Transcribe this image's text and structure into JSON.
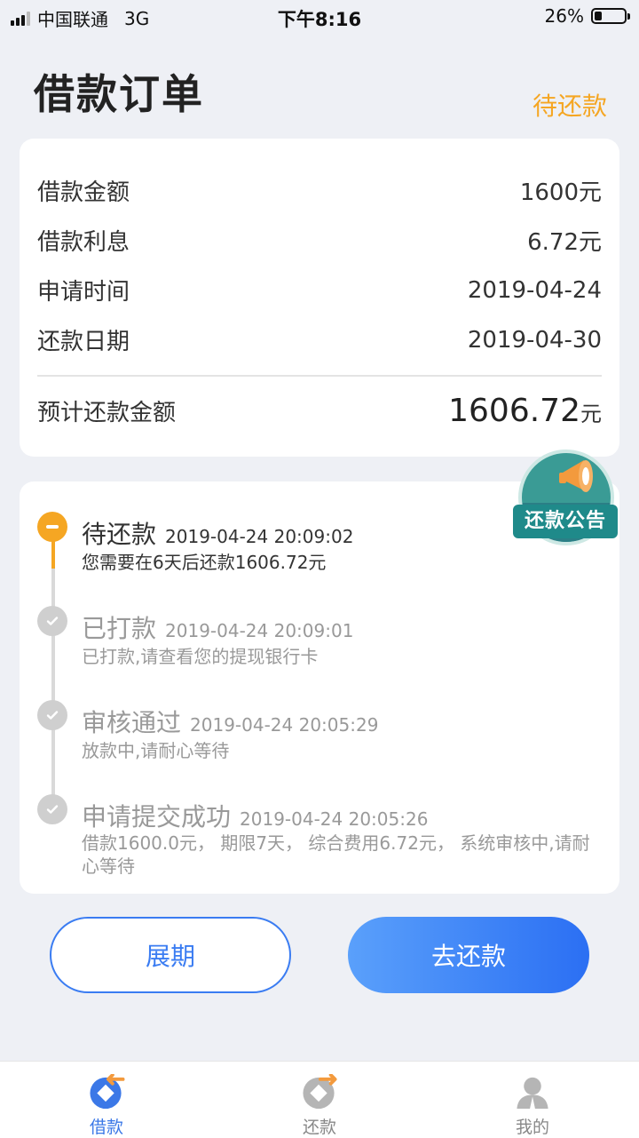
{
  "status_bar": {
    "carrier": "中国联通",
    "network": "3G",
    "time": "下午8:16",
    "battery": "26%",
    "battery_level": 0.26
  },
  "header": {
    "title": "借款订单",
    "status": "待还款"
  },
  "summary": {
    "rows": [
      {
        "label": "借款金额",
        "value": "1600元"
      },
      {
        "label": "借款利息",
        "value": "6.72元"
      },
      {
        "label": "申请时间",
        "value": "2019-04-24"
      },
      {
        "label": "还款日期",
        "value": "2019-04-30"
      }
    ],
    "total": {
      "label": "预计还款金额",
      "value": "1606.72",
      "unit": "元"
    }
  },
  "timeline": [
    {
      "title": "待还款",
      "time": "2019-04-24 20:09:02",
      "desc": "您需要在6天后还款1606.72元",
      "state": "active"
    },
    {
      "title": "已打款",
      "time": "2019-04-24 20:09:01",
      "desc": "已打款,请查看您的提现银行卡",
      "state": "done"
    },
    {
      "title": "审核通过",
      "time": "2019-04-24 20:05:29",
      "desc": "放款中,请耐心等待",
      "state": "done"
    },
    {
      "title": "申请提交成功",
      "time": "2019-04-24 20:05:26",
      "desc": "借款1600.0元， 期限7天， 综合费用6.72元， 系统审核中,请耐心等待",
      "state": "done"
    }
  ],
  "notice_badge": {
    "label": "还款公告"
  },
  "actions": {
    "extend": "展期",
    "repay": "去还款"
  },
  "tabbar": [
    {
      "label": "借款",
      "icon": "loan-icon",
      "active": true
    },
    {
      "label": "还款",
      "icon": "repay-icon",
      "active": false
    },
    {
      "label": "我的",
      "icon": "profile-icon",
      "active": false
    }
  ],
  "colors": {
    "accent": "#3b78e7",
    "pending": "#f5a623",
    "done": "#cfcfcf"
  }
}
